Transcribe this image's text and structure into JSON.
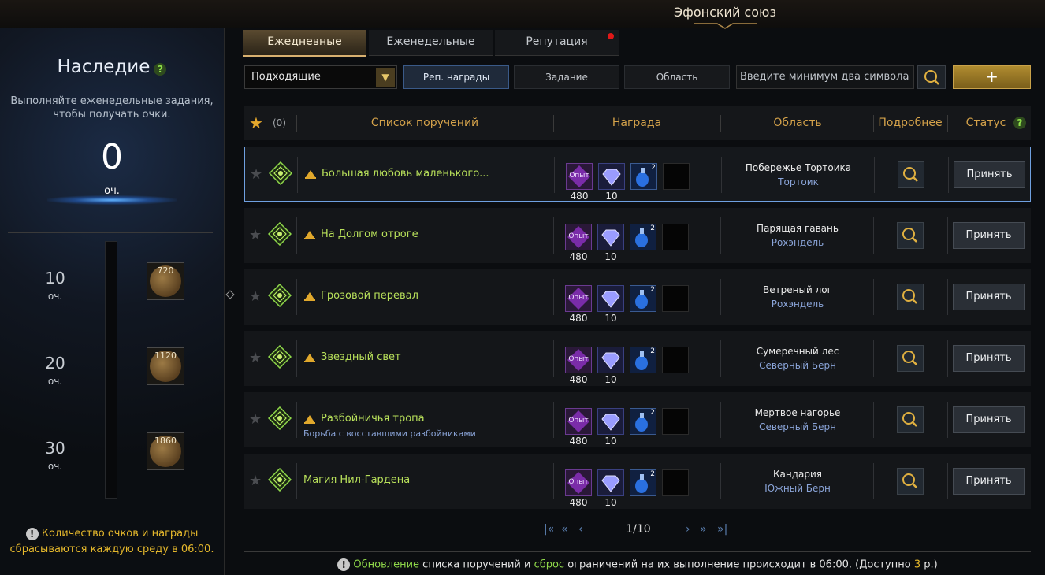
{
  "window": {
    "title": "Эфонский союз"
  },
  "left": {
    "title": "Наследие",
    "help": "?",
    "description": "Выполняйте еженедельные задания, чтобы получать очки.",
    "score": "0",
    "score_unit": "оч.",
    "milestones": [
      {
        "value": "10",
        "unit": "оч.",
        "reward": "720"
      },
      {
        "value": "20",
        "unit": "оч.",
        "reward": "1120"
      },
      {
        "value": "30",
        "unit": "оч.",
        "reward": "1860"
      }
    ],
    "progress_fraction": 0,
    "note": "Количество очков и награды сбрасываются каждую среду в 06:00."
  },
  "tabs": [
    {
      "label": "Ежедневные",
      "active": true
    },
    {
      "label": "Еженедельные",
      "active": false
    },
    {
      "label": "Репутация",
      "active": false,
      "notify": true
    }
  ],
  "filters": {
    "dropdown": "Подходящие",
    "buttons": [
      {
        "label": "Реп. награды",
        "active": true
      },
      {
        "label": "Задание",
        "active": false
      },
      {
        "label": "Область",
        "active": false
      }
    ],
    "search_placeholder": "Введите минимум два символа",
    "add_label": "+"
  },
  "table": {
    "favorites_count": "(0)",
    "headers": {
      "list": "Список поручений",
      "reward": "Награда",
      "area": "Область",
      "details": "Подробнее",
      "status": "Статус",
      "help": "?"
    },
    "rows": [
      {
        "name": "Большая любовь маленького...",
        "sub": "",
        "has_flag": true,
        "rewards": [
          "480",
          "10"
        ],
        "place": "Побережье Тортоика",
        "region": "Тортоик",
        "action": "Принять",
        "selected": true
      },
      {
        "name": "На Долгом отроге",
        "sub": "",
        "has_flag": true,
        "rewards": [
          "480",
          "10"
        ],
        "place": "Парящая гавань",
        "region": "Рохэндель",
        "action": "Принять",
        "selected": false
      },
      {
        "name": "Грозовой перевал",
        "sub": "",
        "has_flag": true,
        "rewards": [
          "480",
          "10"
        ],
        "place": "Ветреный лог",
        "region": "Рохэндель",
        "action": "Принять",
        "selected": false
      },
      {
        "name": "Звездный свет",
        "sub": "",
        "has_flag": true,
        "rewards": [
          "480",
          "10"
        ],
        "place": "Сумеречный лес",
        "region": "Северный Берн",
        "action": "Принять",
        "selected": false
      },
      {
        "name": "Разбойничья тропа",
        "sub": "Борьба с восставшими разбойниками",
        "has_flag": true,
        "rewards": [
          "480",
          "10"
        ],
        "place": "Мертвое нагорье",
        "region": "Северный Берн",
        "action": "Принять",
        "selected": false
      },
      {
        "name": "Магия Нил-Гардена",
        "sub": "",
        "has_flag": false,
        "rewards": [
          "480",
          "10"
        ],
        "place": "Кандария",
        "region": "Южный Берн",
        "action": "Принять",
        "selected": false
      }
    ],
    "reward_labels": {
      "xp": "Опыт",
      "potion_count": "2"
    }
  },
  "pager": {
    "text": "1/10"
  },
  "footer": {
    "part1": "Обновление",
    "part2": " списка поручений и ",
    "part3": "сброс",
    "part4": " ограничений на их выполнение происходит в 06:00. (Доступно ",
    "part5": "3",
    "part6": " р.)"
  },
  "colors": {
    "accent_gold": "#d4a24a",
    "quest_green": "#b8e05a",
    "region_blue": "#8aa4d8",
    "note_yellow": "#e5b82c"
  }
}
